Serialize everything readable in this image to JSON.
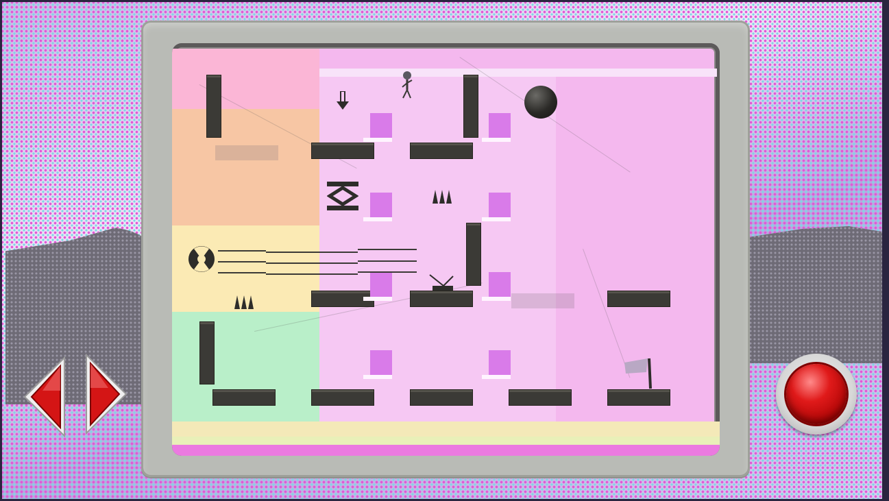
{
  "game": {
    "colors": {
      "accent_red": "#e01a1a",
      "platform": "#3b3a36",
      "screen_bg": "#f4b8ee",
      "block": "#d97be9",
      "bezel": "#b9bbb6"
    },
    "icons": {
      "left_button": "left-arrow-icon",
      "right_button": "right-arrow-icon",
      "action_button": "red-round-button-icon",
      "player": "stick-figure-icon",
      "ball": "boulder-icon",
      "goal": "goal-flag-icon",
      "fan": "fan-icon",
      "spikes": "spike-icon",
      "spring": "spring-icon",
      "lever": "lever-icon",
      "down_arrow": "down-arrow-icon"
    }
  }
}
